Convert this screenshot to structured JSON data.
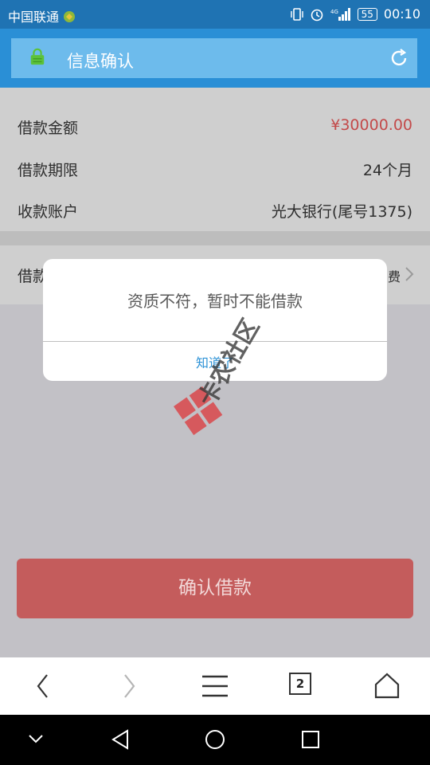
{
  "status_bar": {
    "carrier": "中国联通",
    "battery": "55",
    "time": "00:10",
    "icons": [
      "vibrate-icon",
      "alarm-icon",
      "4g-signal-icon",
      "battery-icon"
    ]
  },
  "header": {
    "title": "信息确认",
    "icons": [
      "lock-icon",
      "refresh-icon"
    ]
  },
  "loan_info": {
    "rows": [
      {
        "label": "借款金额",
        "value": "¥30000.00"
      },
      {
        "label": "借款期限",
        "value": "24个月"
      },
      {
        "label": "收款账户",
        "value": "光大银行(尾号1375)"
      }
    ]
  },
  "fee_row": {
    "label_partial": "借款",
    "tail_partial": "费"
  },
  "dialog": {
    "message": "资质不符，暂时不能借款",
    "ok_label": "知道了"
  },
  "confirm_button": {
    "label": "确认借款"
  },
  "browser_toolbar": {
    "tab_count": "2",
    "icons": [
      "back-icon",
      "forward-icon",
      "menu-icon",
      "tabs-icon",
      "home-icon"
    ]
  },
  "system_nav": {
    "icons": [
      "collapse-icon",
      "nav-back-icon",
      "nav-home-icon",
      "nav-recent-icon"
    ]
  },
  "watermark": {
    "text": "卡农社区"
  },
  "colors": {
    "status_bar": "#1f73b3",
    "header_bar": "#6dbbec",
    "amount_red": "#c34a4a",
    "confirm_button": "#c45c5c",
    "link_blue": "#2c92d6"
  }
}
